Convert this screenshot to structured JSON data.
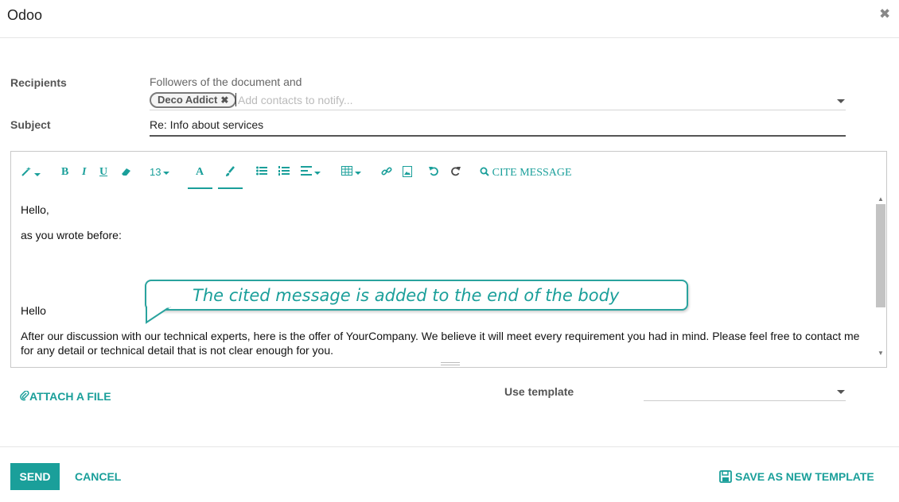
{
  "dialog": {
    "title": "Odoo",
    "close_icon": "close-icon"
  },
  "form": {
    "recipients_label": "Recipients",
    "followers_text": "Followers of the document and",
    "recipient_tags": [
      {
        "name": "Deco Addict"
      }
    ],
    "recipients_placeholder": "Add contacts to notify...",
    "subject_label": "Subject",
    "subject_value": "Re: Info about services"
  },
  "toolbar": {
    "font_size": "13",
    "text_color_letter": "A",
    "bold": "B",
    "italic": "I",
    "underline": "U",
    "cite_label": "CITE MESSAGE",
    "icons": [
      "magic-wand-icon",
      "bold-icon",
      "italic-icon",
      "underline-icon",
      "eraser-icon",
      "font-size-dropdown",
      "text-color-icon",
      "highlight-brush-icon",
      "bullet-list-icon",
      "numbered-list-icon",
      "align-icon",
      "table-icon",
      "link-icon",
      "image-icon",
      "undo-icon",
      "redo-icon",
      "search-icon"
    ]
  },
  "body": {
    "lines": [
      "Hello,",
      "as you wrote before:",
      "Hello",
      "After our discussion with our technical experts, here is the offer of YourCompany. We believe it will meet every requirement you had in mind. Please feel free to contact me for any detail or technical detail that is not clear enough for you."
    ]
  },
  "callout": {
    "text": "The cited message is added to the end of the body"
  },
  "attachments": {
    "attach_label": "ATTACH A FILE"
  },
  "template": {
    "label": "Use template",
    "value": ""
  },
  "footer": {
    "send_label": "SEND",
    "cancel_label": "CANCEL",
    "save_template_label": "SAVE AS NEW TEMPLATE"
  },
  "colors": {
    "accent": "#1a9f9a",
    "text": "#4c4c4c"
  }
}
